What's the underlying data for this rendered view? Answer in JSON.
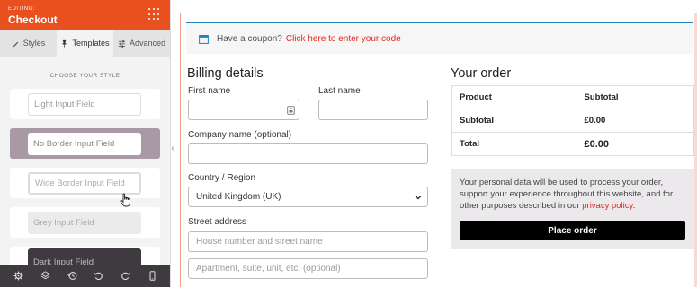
{
  "panel": {
    "editing_label": "EDITING:",
    "title": "Checkout",
    "tabs": [
      {
        "label": "Styles",
        "icon": "brush-icon"
      },
      {
        "label": "Templates",
        "icon": "pin-icon",
        "active": true
      },
      {
        "label": "Advanced",
        "icon": "sliders-icon"
      }
    ],
    "choose_label": "CHOOSE YOUR STYLE",
    "styles": [
      {
        "label": "Light Input Field"
      },
      {
        "label": "No Border Input Field",
        "selected": true
      },
      {
        "label": "Wide Border Input Field"
      },
      {
        "label": "Grey Input Field"
      },
      {
        "label": "Dark Input Field"
      }
    ],
    "bottom_icons": [
      "settings-icon",
      "layers-icon",
      "history-icon",
      "undo-icon",
      "redo-icon",
      "mobile-icon"
    ],
    "colors": {
      "header": "#e8501f",
      "selected_card": "#a899a4",
      "bottom_bar": "#3f3a3f"
    }
  },
  "coupon": {
    "text": "Have a coupon?",
    "link": "Click here to enter your code"
  },
  "billing": {
    "title": "Billing details",
    "first_name": "First name",
    "last_name": "Last name",
    "company": "Company name (optional)",
    "country_label": "Country / Region",
    "country_value": "United Kingdom (UK)",
    "street_label": "Street address",
    "street1_placeholder": "House number and street name",
    "street2_placeholder": "Apartment, suite, unit, etc. (optional)"
  },
  "order": {
    "title": "Your order",
    "col_product": "Product",
    "col_subtotal": "Subtotal",
    "rows": [
      {
        "label": "Subtotal",
        "value": "£0.00"
      },
      {
        "label": "Total",
        "value": "£0.00"
      }
    ],
    "privacy_text": "Your personal data will be used to process your order, support your experience throughout this website, and for other purposes described in our",
    "privacy_link": "privacy policy",
    "privacy_end": ".",
    "place_order": "Place order"
  }
}
